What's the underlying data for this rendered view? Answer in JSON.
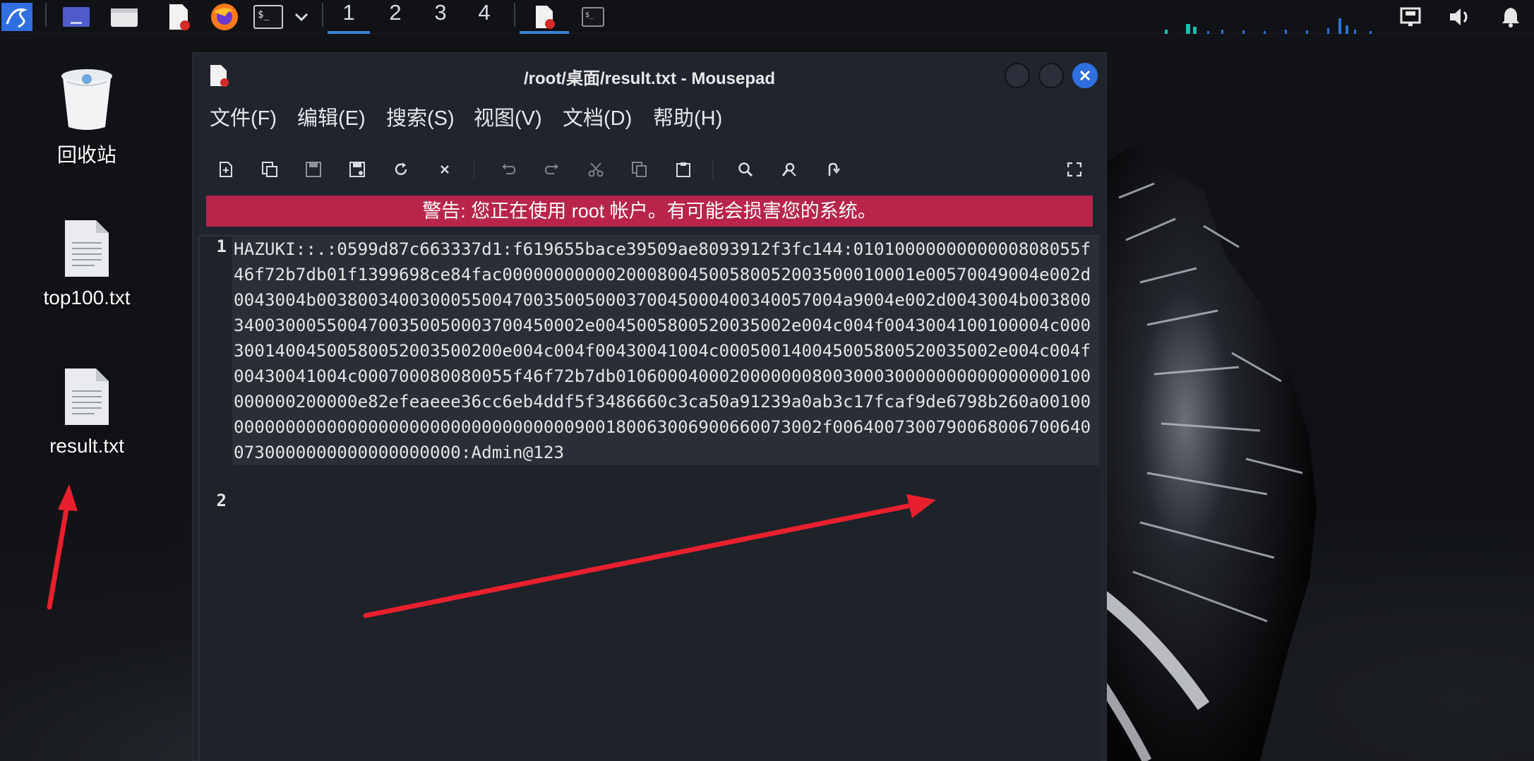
{
  "top_panel": {
    "workspaces": [
      "1",
      "2",
      "3",
      "4"
    ],
    "active_workspace": "1",
    "icons": [
      "kali-menu-icon",
      "desktop-icon",
      "file-manager-icon",
      "mousepad-icon",
      "firefox-icon",
      "terminal-icon",
      "dropdown-chevron-icon",
      "mousepad-task-icon",
      "terminal-task-icon",
      "network-icon",
      "volume-icon",
      "notification-bell-icon"
    ]
  },
  "desktop": {
    "icons": [
      {
        "label": "回收站",
        "icon": "trash-icon"
      },
      {
        "label": "top100.txt",
        "icon": "text-file-icon"
      },
      {
        "label": "result.txt",
        "icon": "text-file-icon"
      }
    ]
  },
  "window": {
    "title": "/root/桌面/result.txt - Mousepad",
    "menu": [
      "文件(F)",
      "编辑(E)",
      "搜索(S)",
      "视图(V)",
      "文档(D)",
      "帮助(H)"
    ],
    "toolbar": [
      "new-document",
      "new-window",
      "save",
      "save-as",
      "reload",
      "close",
      "undo",
      "redo",
      "cut",
      "copy",
      "paste",
      "find",
      "find-replace",
      "go-to-line",
      "fullscreen"
    ],
    "warning": "警告: 您正在使用 root 帐户。有可能会损害您的系统。",
    "lines": [
      {
        "number": "1",
        "text": "HAZUKI::.:0599d87c663337d1:f619655bace39509ae8093912f3fc144:0101000000000000808055f46f72b7db01f1399698ce84fac0000000000020008004500580052003500010001e00570049004e002d0043004b003800340030005500470035005000370045000400340057004a9004e002d0043004b0038003400300055004700350050003700450002e0045005800520035002e004c004f0043004100100004c00030014004500580052003500200e004c004f00430041004c000500140045005800520035002e004c004f00430041004c000700080080055f46f72b7db0106000400020000000800300030000000000000000100000000200000e82efeaeee36cc6eb4ddf5f3486660c3ca50a91239a0ab3c17fcaf9de6798b260a00100000000000000000000000000000000000900180063006900660073002f00640073007900680067006400730000000000000000000:Admin@123"
      },
      {
        "number": "2",
        "text": ""
      }
    ]
  },
  "colors": {
    "warning_bg": "#b8244a",
    "accent": "#3b82d6",
    "annotation_arrow": "#e8202e"
  }
}
